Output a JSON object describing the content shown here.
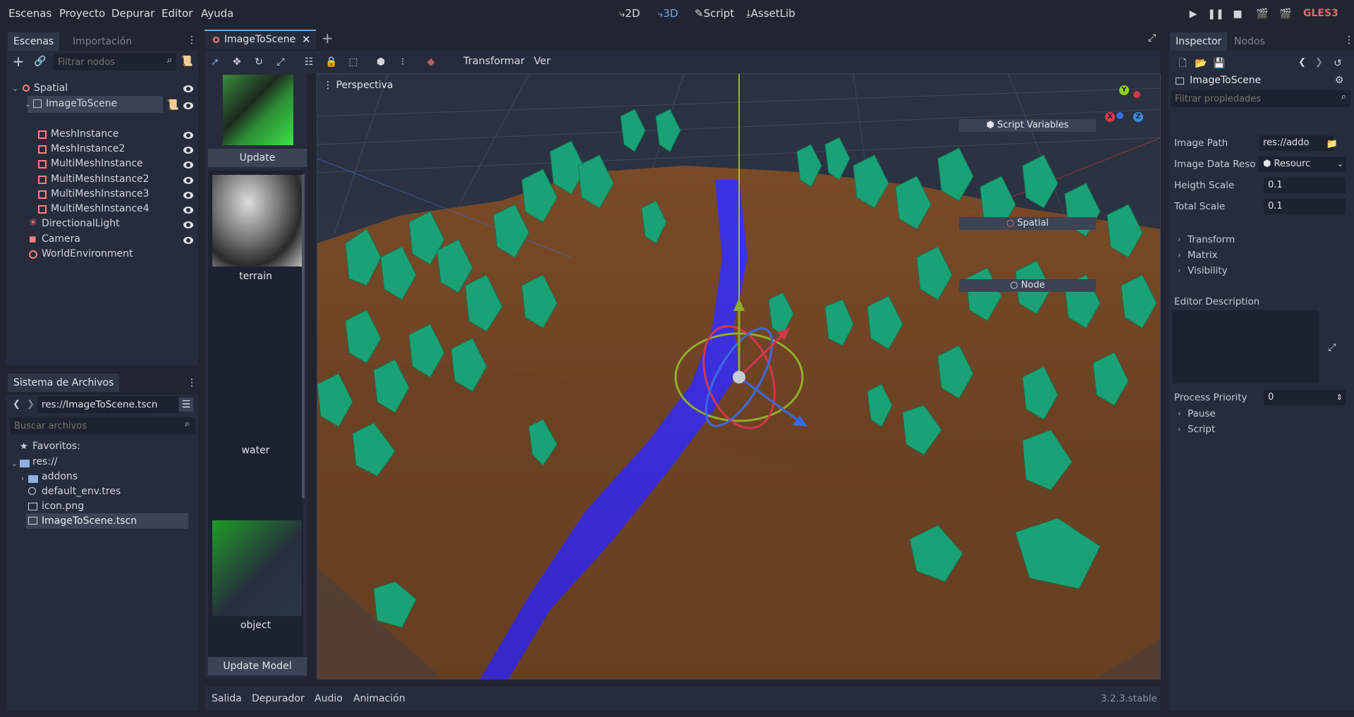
{
  "menubar": {
    "menus": [
      "Escenas",
      "Proyecto",
      "Depurar",
      "Editor",
      "Ayuda"
    ],
    "modes": [
      "2D",
      "3D",
      "Script",
      "AssetLib"
    ],
    "renderer": "GLES3"
  },
  "scene_dock": {
    "tabs": [
      "Escenas",
      "Importación"
    ],
    "filter_placeholder": "Filtrar nodos",
    "tree": [
      {
        "label": "Spatial"
      },
      {
        "label": "ImageToScene"
      },
      {
        "label": "MeshInstance"
      },
      {
        "label": "MeshInstance2"
      },
      {
        "label": "MultiMeshInstance"
      },
      {
        "label": "MultiMeshInstance2"
      },
      {
        "label": "MultiMeshInstance3"
      },
      {
        "label": "MultiMeshInstance4"
      },
      {
        "label": "DirectionalLight"
      },
      {
        "label": "Camera"
      },
      {
        "label": "WorldEnvironment"
      }
    ]
  },
  "filesystem": {
    "title": "Sistema de Archivos",
    "path": "res://ImageToScene.tscn",
    "search_placeholder": "Buscar archivos",
    "favorites": "Favoritos:",
    "root": "res://",
    "items": [
      "addons",
      "default_env.tres",
      "icon.png",
      "ImageToScene.tscn"
    ]
  },
  "scene_tab": {
    "label": "ImageToScene"
  },
  "toolbar": {
    "transform": "Transformar",
    "view": "Ver"
  },
  "image_panel": {
    "update": "Update",
    "layers": [
      "terrain",
      "water",
      "object"
    ],
    "update_model": "Update Model"
  },
  "viewport": {
    "label": "Perspectiva",
    "gizmo_axes": [
      "Y",
      "X",
      "Z"
    ]
  },
  "inspector": {
    "tabs": [
      "Inspector",
      "Nodos"
    ],
    "node_name": "ImageToScene",
    "filter_placeholder": "Filtrar propiedades",
    "script_variables": "Script Variables",
    "image_path_label": "Image Path",
    "image_path_value": "res://addo",
    "image_data_label": "Image Data Reso",
    "image_data_value": "Resourc",
    "height_scale_label": "Heigth Scale",
    "height_scale_value": "0.1",
    "total_scale_label": "Total Scale",
    "total_scale_value": "0.1",
    "spatial_section": "Spatial",
    "spatial_items": [
      "Transform",
      "Matrix",
      "Visibility"
    ],
    "node_section": "Node",
    "editor_description": "Editor Description",
    "process_priority_label": "Process Priority",
    "process_priority_value": "0",
    "node_items": [
      "Pause",
      "Script"
    ]
  },
  "bottom_panel": {
    "tabs": [
      "Salida",
      "Depurador",
      "Audio",
      "Animación"
    ],
    "version": "3.2.3.stable"
  },
  "colors": {
    "accent": "#6fa8ff",
    "background": "#202531",
    "panel": "#262c3b",
    "terrain": "#6b4225",
    "water": "#3a2fd8",
    "trees": "#1a9a6c"
  }
}
